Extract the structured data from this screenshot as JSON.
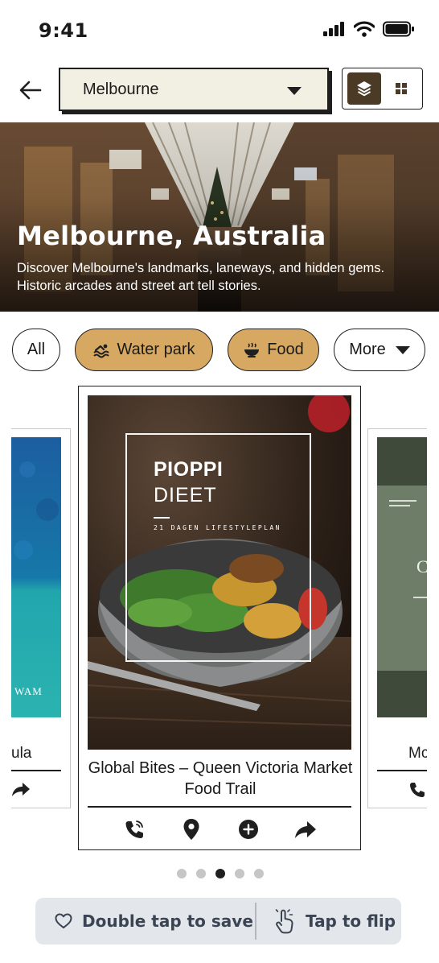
{
  "status_bar": {
    "time": "9:41"
  },
  "header": {
    "city": "Melbourne",
    "view_options": [
      "layers",
      "grid"
    ]
  },
  "hero": {
    "title": "Melbourne, Australia",
    "description": "Discover Melbourne's landmarks, laneways, and hidden gems. Historic arcades and street art tell stories."
  },
  "chips": [
    {
      "label": "All",
      "selected": false
    },
    {
      "label": "Water park",
      "icon": "swimming-icon",
      "selected": true
    },
    {
      "label": "Food",
      "icon": "bowl-icon",
      "selected": true
    },
    {
      "label": "More",
      "selected": false
    }
  ],
  "main_card": {
    "cover_title_1": "PIOPPI",
    "cover_title_2": "DIEET",
    "cover_subtitle": "21 DAGEN LIFESTYLEPLAN",
    "title": "Global Bites – Queen Victoria Market Food Trail",
    "actions": [
      "phone-icon",
      "location-pin-icon",
      "add-icon",
      "share-icon"
    ]
  },
  "side_card_left": {
    "cover_text": "WAM",
    "caption": "ula"
  },
  "side_card_right": {
    "caption": "Mc"
  },
  "pagination": {
    "total": 5,
    "active_index": 2
  },
  "bottom_bar": {
    "save_label": "Double tap to save",
    "flip_label": "Tap to flip"
  },
  "colors": {
    "accent_tan": "#d6a862",
    "dark_brown": "#4a3a26",
    "select_bg": "#f2efe3",
    "bottom_bar_bg": "#e3e6ea"
  }
}
